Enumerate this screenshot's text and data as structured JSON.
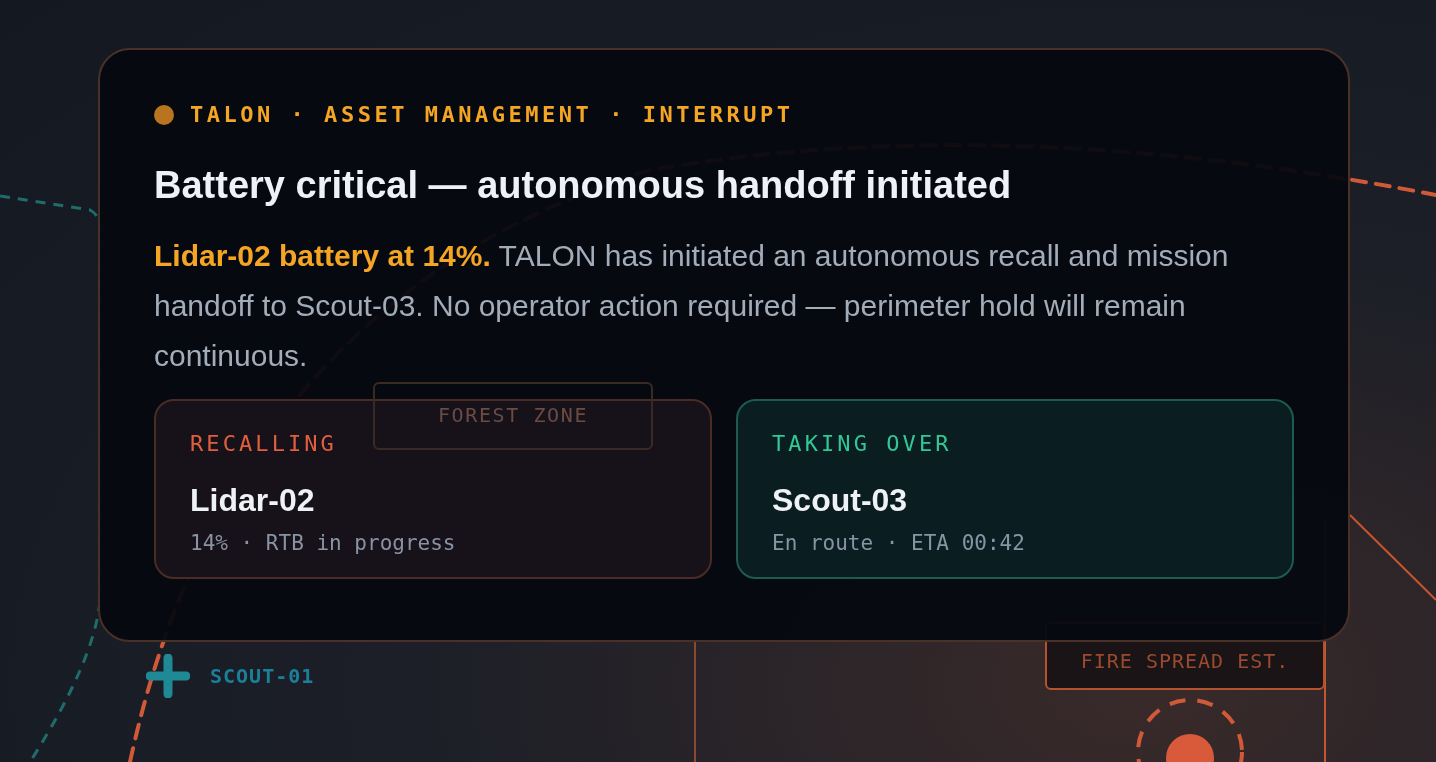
{
  "map": {
    "labels": [
      {
        "kind": "zone",
        "text": "FOREST ZONE"
      },
      {
        "kind": "fire",
        "text": "FIRE SPREAD EST."
      },
      {
        "kind": "unit",
        "text": "SCOUT-01"
      }
    ]
  },
  "alert": {
    "source": "TALON · ASSET MANAGEMENT · INTERRUPT",
    "title": "Battery critical — autonomous handoff initiated",
    "message": "**Lidar-02 battery at 14%.** TALON has initiated an autonomous recall and mission handoff to Scout-03. No operator action required — perimeter hold will remain continuous."
  },
  "assets": [
    {
      "kind": "recall",
      "status": "RECALLING",
      "name": "Lidar-02",
      "detail": "14% · RTB in progress"
    },
    {
      "kind": "takeover",
      "status": "TAKING OVER",
      "name": "Scout-03",
      "detail": "En route · ETA 00:42"
    }
  ]
}
